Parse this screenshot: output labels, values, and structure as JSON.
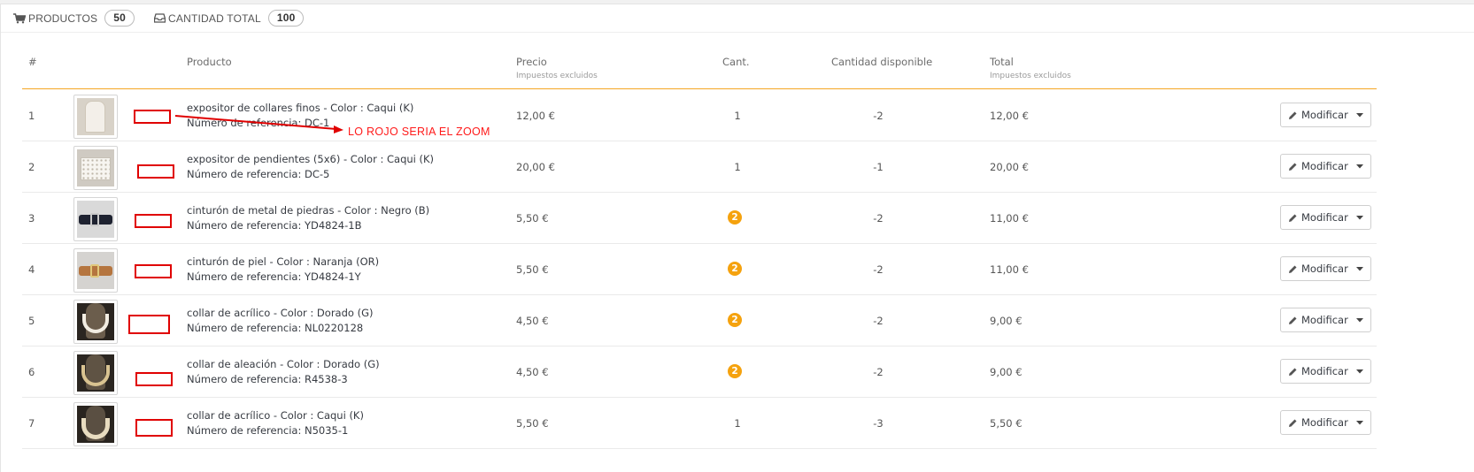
{
  "summary": {
    "products_label": "PRODUCTOS",
    "products_count": "50",
    "quantity_label": "CANTIDAD TOTAL",
    "quantity_count": "100",
    "products_icon": "shopping-cart-icon",
    "quantity_icon": "inbox-icon"
  },
  "table": {
    "headers": {
      "num": "#",
      "product": "Producto",
      "price": "Precio",
      "price_sub": "Impuestos excluidos",
      "qty": "Cant.",
      "available": "Cantidad disponible",
      "total": "Total",
      "total_sub": "Impuestos excluidos"
    },
    "rows": [
      {
        "num": "1",
        "name": "expositor de collares finos - Color : Caqui (K)",
        "ref": "Número de referencia: DC-1",
        "price": "12,00 €",
        "qty": "1",
        "available": "-2",
        "total": "12,00 €",
        "action": "Modificar"
      },
      {
        "num": "2",
        "name": "expositor de pendientes (5x6) - Color : Caqui (K)",
        "ref": "Número de referencia: DC-5",
        "price": "20,00 €",
        "qty": "1",
        "available": "-1",
        "total": "20,00 €",
        "action": "Modificar"
      },
      {
        "num": "3",
        "name": "cinturón de metal de piedras - Color : Negro (B)",
        "ref": "Número de referencia: YD4824-1B",
        "price": "5,50 €",
        "qty": "2",
        "available": "-2",
        "total": "11,00 €",
        "action": "Modificar"
      },
      {
        "num": "4",
        "name": "cinturón de piel - Color : Naranja (OR)",
        "ref": "Número de referencia: YD4824-1Y",
        "price": "5,50 €",
        "qty": "2",
        "available": "-2",
        "total": "11,00 €",
        "action": "Modificar"
      },
      {
        "num": "5",
        "name": "collar de acrílico - Color : Dorado (G)",
        "ref": "Número de referencia: NL0220128",
        "price": "4,50 €",
        "qty": "2",
        "available": "-2",
        "total": "9,00 €",
        "action": "Modificar"
      },
      {
        "num": "6",
        "name": "collar de aleación - Color : Dorado (G)",
        "ref": "Número de referencia: R4538-3",
        "price": "4,50 €",
        "qty": "2",
        "available": "-2",
        "total": "9,00 €",
        "action": "Modificar"
      },
      {
        "num": "7",
        "name": "collar de acrílico - Color : Caqui (K)",
        "ref": "Número de referencia: N5035-1",
        "price": "5,50 €",
        "qty": "1",
        "available": "-3",
        "total": "5,50 €",
        "action": "Modificar"
      }
    ]
  },
  "annotation": {
    "text": "LO ROJO SERIA EL ZOOM",
    "color": "#ff1a1a"
  },
  "colors": {
    "accent_line": "#f5a623",
    "qty_badge": "#f5a20e",
    "annotation_red": "#e00000"
  }
}
